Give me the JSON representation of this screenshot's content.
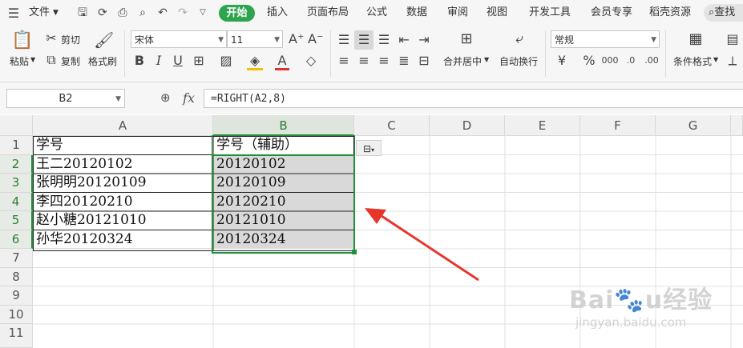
{
  "menu": {
    "file": "文件",
    "tabs": [
      "开始",
      "插入",
      "页面布局",
      "公式",
      "数据",
      "审阅",
      "视图",
      "开发工具",
      "会员专享",
      "稻壳资源"
    ],
    "search": "查找"
  },
  "ribbon": {
    "paste": "粘贴",
    "cut": "剪切",
    "copy": "复制",
    "format_painter": "格式刷",
    "font_name": "宋体",
    "font_size": "11",
    "merge_center": "合并居中",
    "wrap_text": "自动换行",
    "number_format": "常规",
    "conditional_format": "条件格式"
  },
  "formula_bar": {
    "name_box": "B2",
    "fx": "fx",
    "formula": "=RIGHT(A2,8)"
  },
  "sheet": {
    "columns": [
      "A",
      "B",
      "C",
      "D",
      "E",
      "F",
      "G"
    ],
    "rows": [
      "1",
      "2",
      "3",
      "4",
      "5",
      "6",
      "7",
      "8",
      "9",
      "10",
      "11"
    ],
    "col_a": [
      "学号",
      "王二20120102",
      "张明明20120109",
      "李四20120210",
      "赵小糖20121010",
      "孙华20120324"
    ],
    "col_b": [
      "学号（辅助）",
      "20120102",
      "20120109",
      "20120210",
      "20121010",
      "20120324"
    ]
  },
  "colors": {
    "accent": "#2da44e",
    "selection_border": "#1f8f3a",
    "selection_fill": "#d9d9d9",
    "arrow": "#e8352c"
  },
  "watermark": "Baidu经验 jingyan.baidu.com"
}
